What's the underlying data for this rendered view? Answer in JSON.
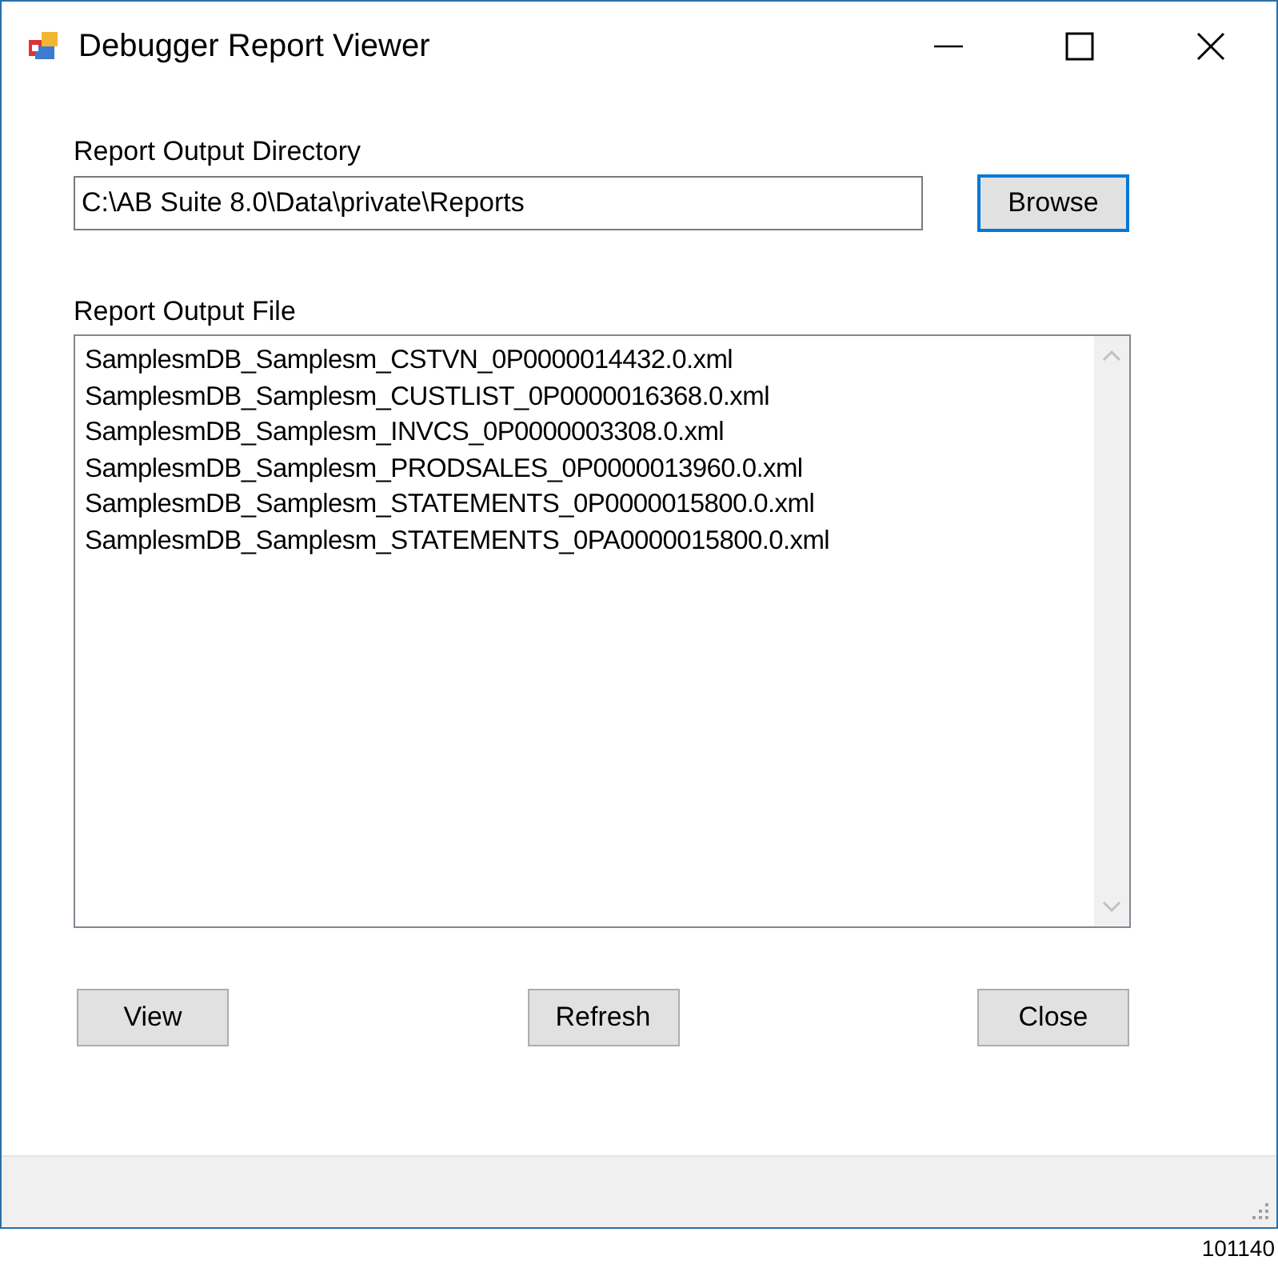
{
  "window": {
    "title": "Debugger Report Viewer"
  },
  "directory": {
    "label": "Report Output Directory",
    "value": "C:\\AB Suite 8.0\\Data\\private\\Reports",
    "browse_button": {
      "label": "Browse",
      "focused": true
    }
  },
  "file_list": {
    "label": "Report Output File",
    "items": [
      {
        "text": "SamplesmDB_Samplesm_CSTVN_0P0000014432.0.xml",
        "selected": false
      },
      {
        "text": "SamplesmDB_Samplesm_CUSTLIST_0P0000016368.0.xml",
        "selected": false
      },
      {
        "text": "SamplesmDB_Samplesm_INVCS_0P0000003308.0.xml",
        "selected": false
      },
      {
        "text": "SamplesmDB_Samplesm_PRODSALES_0P0000013960.0.xml",
        "selected": false
      },
      {
        "text": "SamplesmDB_Samplesm_STATEMENTS_0P0000015800.0.xml",
        "selected": false
      },
      {
        "text": "SamplesmDB_Samplesm_STATEMENTS_0PA0000015800.0.xml",
        "selected": false
      }
    ]
  },
  "buttons": [
    {
      "label": "View",
      "focused": false
    },
    {
      "label": "Refresh",
      "focused": false
    },
    {
      "label": "Close",
      "focused": false
    }
  ],
  "figure_number": "101140"
}
